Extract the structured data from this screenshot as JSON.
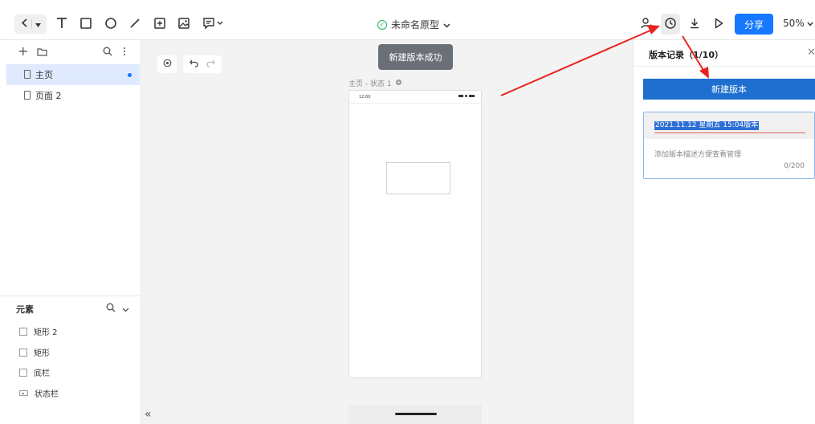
{
  "toolbar": {
    "title": "未命名原型",
    "share_label": "分享",
    "zoom": "50%",
    "icons": [
      "back-icon",
      "dropdown-icon",
      "text-icon",
      "rectangle-icon",
      "circle-icon",
      "line-icon",
      "component-icon",
      "image-icon",
      "comment-icon",
      "collaborator-icon",
      "history-icon",
      "download-icon",
      "play-icon"
    ]
  },
  "left_panel": {
    "pages": [
      {
        "label": "主页",
        "active": true
      },
      {
        "label": "页面 2",
        "active": false
      }
    ],
    "elements_header": "元素",
    "elements": [
      {
        "label": "矩形 2",
        "icon": "rectangle-icon"
      },
      {
        "label": "矩形",
        "icon": "rectangle-icon"
      },
      {
        "label": "底栏",
        "icon": "rectangle-icon"
      },
      {
        "label": "状态栏",
        "icon": "statusbar-icon"
      }
    ]
  },
  "canvas": {
    "toast": "新建版本成功",
    "frame_label": "主页 - 状态 1",
    "phone_time": "12:00",
    "collapse_label": "«"
  },
  "right_panel": {
    "title": "版本记录（1/10）",
    "new_version_label": "新建版本",
    "version_name": "2021.11.12 星期五 15:04版本",
    "description_placeholder": "添加版本描述方便查看管理",
    "char_count": "0/200"
  },
  "colors": {
    "accent": "#1677ff",
    "new_version_button": "#1e6fd0",
    "success": "#21b35f",
    "annotation_arrow": "#e8231f"
  }
}
